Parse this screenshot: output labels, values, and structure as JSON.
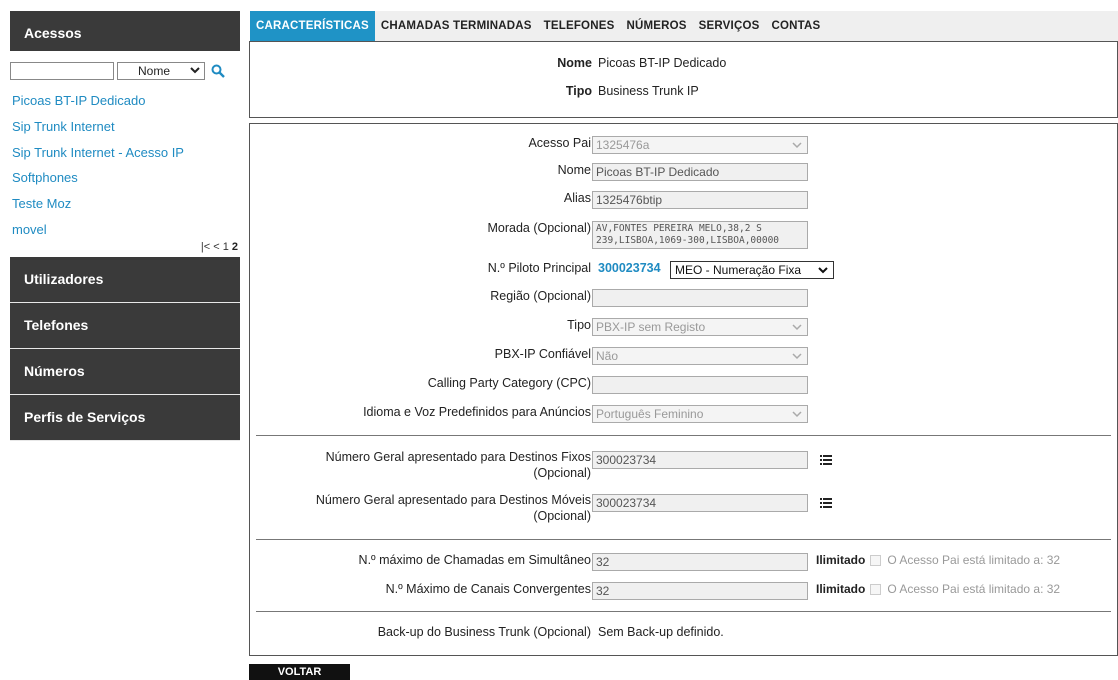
{
  "sidebar": {
    "title": "Acessos",
    "search": {
      "value": "",
      "placeholder": ""
    },
    "filter_selected": "Nome",
    "access_items": [
      "Picoas BT-IP Dedicado",
      "Sip Trunk Internet",
      "Sip Trunk Internet - Acesso IP",
      "Softphones",
      "Teste Moz",
      "movel"
    ],
    "pager": {
      "first": "|<",
      "prev": "<",
      "page1": "1",
      "page2": "2"
    },
    "nav": [
      "Utilizadores",
      "Telefones",
      "Números",
      "Perfis de Serviços"
    ]
  },
  "tabs": [
    "CARACTERÍSTICAS",
    "CHAMADAS TERMINADAS",
    "TELEFONES",
    "NÚMEROS",
    "SERVIÇOS",
    "CONTAS"
  ],
  "summary": {
    "name_label": "Nome",
    "name_value": "Picoas BT-IP Dedicado",
    "type_label": "Tipo",
    "type_value": "Business Trunk IP"
  },
  "form": {
    "parent_access": {
      "label": "Acesso Pai",
      "value": "1325476a"
    },
    "name": {
      "label": "Nome",
      "value": "Picoas BT-IP Dedicado"
    },
    "alias": {
      "label": "Alias",
      "value": "1325476btip"
    },
    "address": {
      "label": "Morada (Opcional)",
      "value": "AV,FONTES PEREIRA MELO,38,2 S\n239,LISBOA,1069-300,LISBOA,00000"
    },
    "pilot": {
      "label": "N.º Piloto Principal",
      "number": "300023734",
      "selected": "MEO - Numeração Fixa"
    },
    "region": {
      "label": "Região (Opcional)",
      "value": ""
    },
    "type": {
      "label": "Tipo",
      "value": "PBX-IP sem Registo"
    },
    "trusted": {
      "label": "PBX-IP Confiável",
      "value": "Não"
    },
    "cpc": {
      "label": "Calling Party Category (CPC)",
      "value": ""
    },
    "language": {
      "label": "Idioma e Voz Predefinidos para Anúncios",
      "value": "Português Feminino"
    },
    "fixed_dest": {
      "label_line1": "Número Geral apresentado para Destinos Fixos",
      "label_line2": "(Opcional)",
      "value": "300023734"
    },
    "mobile_dest": {
      "label_line1": "Número Geral apresentado para Destinos Móveis",
      "label_line2": "(Opcional)",
      "value": "300023734"
    },
    "max_calls": {
      "label": "N.º máximo de Chamadas em Simultâneo",
      "value": "32",
      "unlimited": "Ilimitado",
      "note": "O Acesso Pai está limitado a: 32"
    },
    "max_channels": {
      "label": "N.º Máximo de Canais Convergentes",
      "value": "32",
      "unlimited": "Ilimitado",
      "note": "O Acesso Pai está limitado a: 32"
    },
    "backup": {
      "label": "Back-up do Business Trunk (Opcional)",
      "value": "Sem Back-up definido."
    }
  },
  "back_button": "VOLTAR"
}
